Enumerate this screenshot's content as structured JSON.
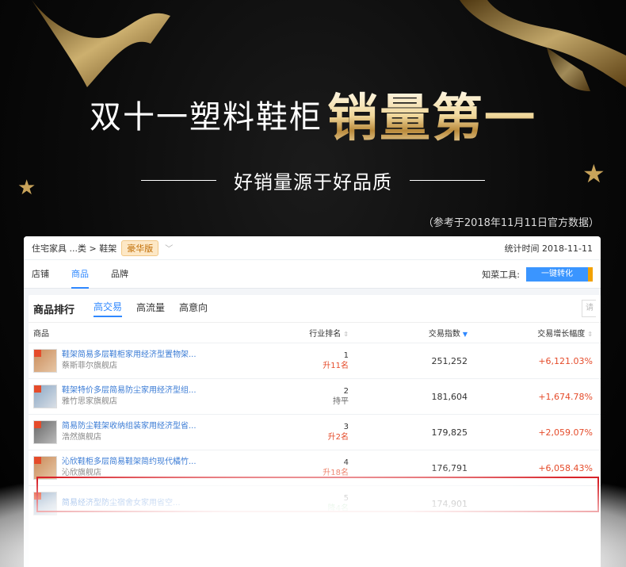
{
  "banner": {
    "headline_small": "双十一塑料鞋柜",
    "headline_big": "销量第一",
    "subtitle": "好销量源于好品质",
    "reference": "（参考于2018年11月11日官方数据）",
    "accent_color": "#d4b06a"
  },
  "breadcrumb": {
    "path": "住宅家具 ...类 > 鞋架",
    "badge": "豪华版",
    "stat_time": "统计时间 2018-11-11"
  },
  "nav": {
    "tabs": [
      "店铺",
      "商品",
      "品牌"
    ],
    "active_tab": "商品",
    "tool_label": "知菜工具:",
    "tool_button": "一键转化"
  },
  "panel": {
    "title": "商品排行",
    "subtabs": [
      "高交易",
      "高流量",
      "高意向"
    ],
    "search_stub": "请"
  },
  "table": {
    "headers": [
      "商品",
      "行业排名",
      "交易指数",
      "交易增长幅度"
    ],
    "rows": [
      {
        "name": "鞋架简易多层鞋柜家用经济型置物架...",
        "shop": "蔡斯菲尔旗舰店",
        "rank": "1",
        "change": "升11名",
        "index": "251,252",
        "growth": "+6,121.03%"
      },
      {
        "name": "鞋架特价多层简易防尘家用经济型组...",
        "shop": "雅竹思家旗舰店",
        "rank": "2",
        "change": "持平",
        "index": "181,604",
        "growth": "+1,674.78%"
      },
      {
        "name": "简易防尘鞋架收纳组装家用经济型省...",
        "shop": "浩然旗舰店",
        "rank": "3",
        "change": "升2名",
        "index": "179,825",
        "growth": "+2,059.07%"
      },
      {
        "name": "沁欣鞋柜多层简易鞋架简约现代橘竹...",
        "shop": "沁欣旗舰店",
        "rank": "4",
        "change": "升18名",
        "index": "176,791",
        "growth": "+6,058.43%"
      },
      {
        "name": "简易经济型防尘宿舍女家用省空...",
        "shop": "",
        "rank": "5",
        "change": "降4名",
        "index": "174,901",
        "growth": ""
      }
    ]
  }
}
